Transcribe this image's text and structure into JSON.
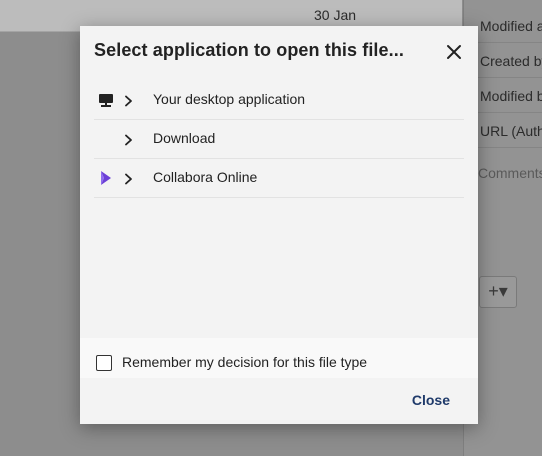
{
  "background": {
    "date_label": "30 Jan",
    "sidebar": {
      "rows": [
        "Modified a",
        "Created by",
        "Modified b",
        "URL (Auth"
      ],
      "comments_label": "Comments",
      "add_button": "+▾"
    }
  },
  "dialog": {
    "title": "Select application to open this file...",
    "apps": [
      {
        "label": "Your desktop application",
        "icon": "desktop-icon"
      },
      {
        "label": "Download",
        "icon": ""
      },
      {
        "label": "Collabora Online",
        "icon": "collabora-icon"
      }
    ],
    "remember_label": "Remember my decision for this file type",
    "remember_checked": false,
    "close_label": "Close"
  },
  "colors": {
    "accent": "#1f3a6a",
    "collabora": "#6b3fd6",
    "overlay": "#8d8d8d"
  }
}
